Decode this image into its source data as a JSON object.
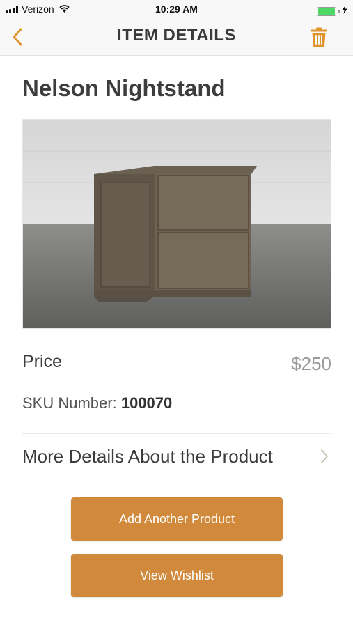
{
  "status_bar": {
    "carrier": "Verizon",
    "time": "10:29 AM",
    "battery_level": 1.0
  },
  "nav": {
    "title": "ITEM DETAILS",
    "back_icon": "chevron-left-icon",
    "delete_icon": "trash-icon"
  },
  "product": {
    "name": "Nelson Nightstand",
    "image_subject": "nightstand-photo",
    "price_label": "Price",
    "price_value": "$250",
    "sku_label": "SKU Number:",
    "sku_value": "100070",
    "more_details_label": "More Details About the Product"
  },
  "actions": {
    "add_another_label": "Add Another Product",
    "view_wishlist_label": "View Wishlist"
  },
  "colors": {
    "accent": "#d18a3b",
    "accent_icon": "#e0932b",
    "battery": "#4cd964"
  }
}
